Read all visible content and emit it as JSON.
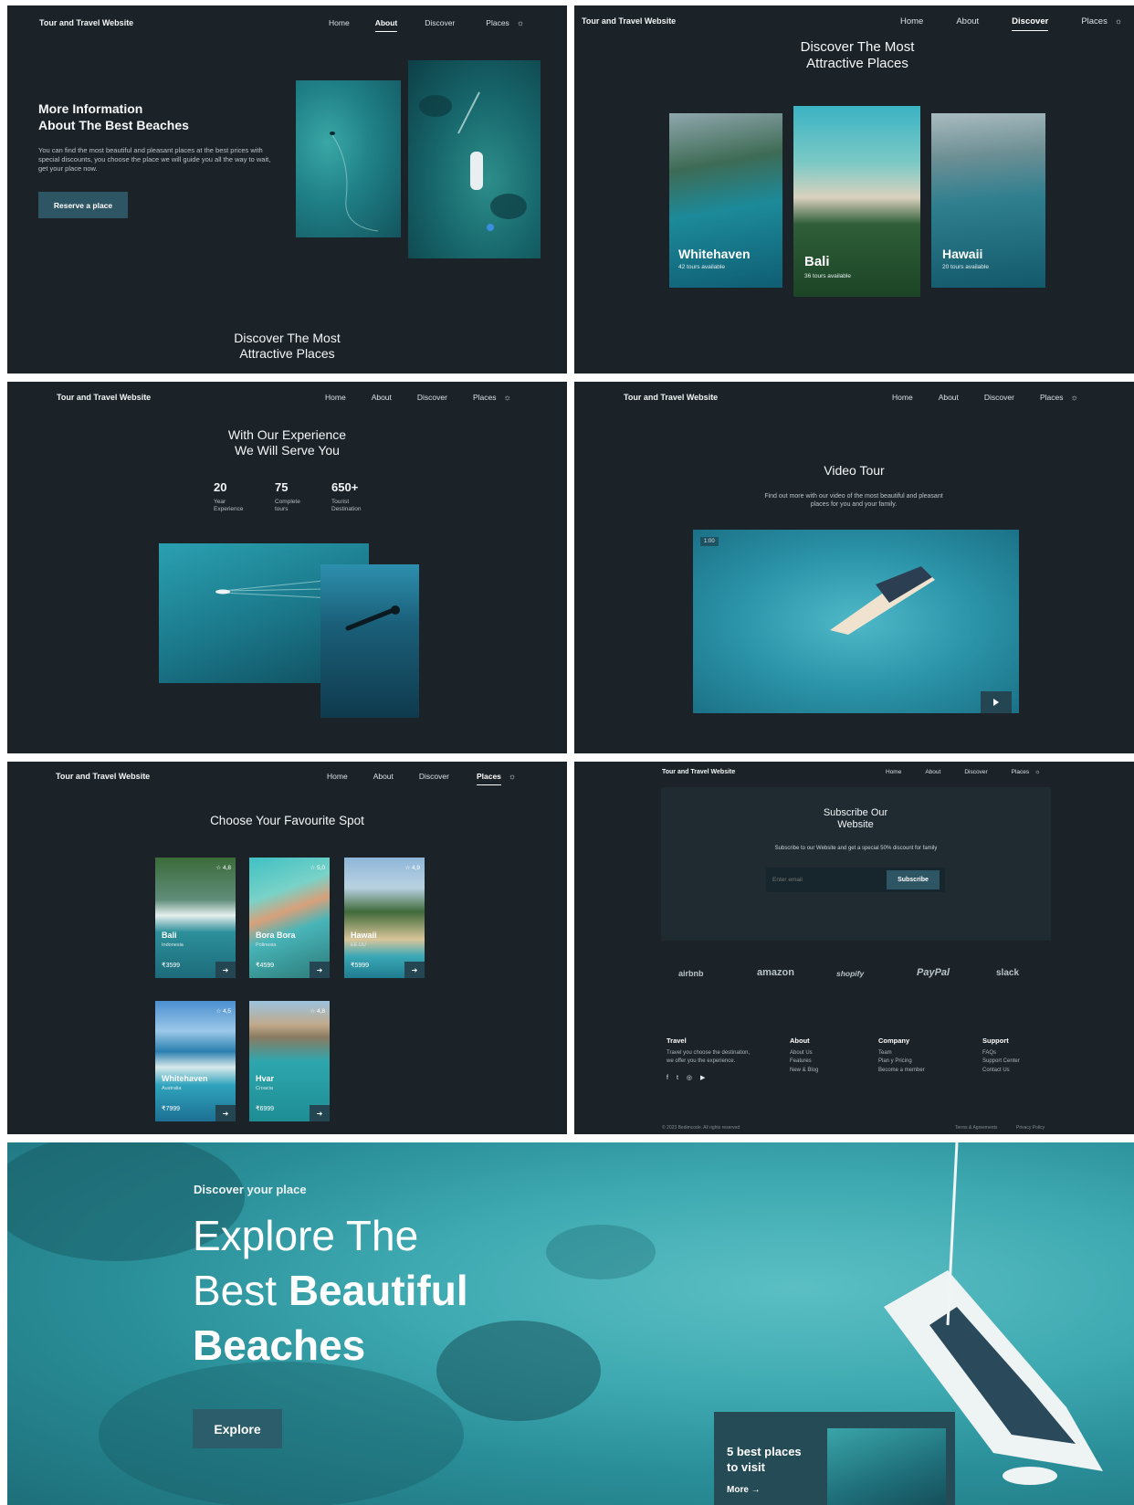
{
  "brand": "Tour and Travel Website",
  "nav": {
    "home": "Home",
    "about": "About",
    "discover": "Discover",
    "places": "Places",
    "theme_icon": "sun-icon"
  },
  "about": {
    "title": "More Information\nAbout The Best Beaches",
    "text": "You can find the most beautiful and pleasant places at the best prices with special discounts, you choose the place we will guide you all the way to wait, get your place now.",
    "button": "Reserve a place",
    "next_title": "Discover The Most\nAttractive Places"
  },
  "discover": {
    "title": "Discover The Most\nAttractive Places",
    "cards": [
      {
        "name": "Whitehaven",
        "tours": "42 tours available"
      },
      {
        "name": "Bali",
        "tours": "36 tours available"
      },
      {
        "name": "Hawaii",
        "tours": "20 tours available"
      }
    ]
  },
  "experience": {
    "title": "With Our Experience\nWe Will Serve You",
    "stats": [
      {
        "num": "20",
        "label": "Year\nExperience"
      },
      {
        "num": "75",
        "label": "Complete\ntours"
      },
      {
        "num": "650+",
        "label": "Tourist\nDestination"
      }
    ]
  },
  "video": {
    "title": "Video Tour",
    "text": "Find out more with our video of the most beautiful and pleasant places for you and your family.",
    "time": "1:00",
    "play_icon": "play-icon"
  },
  "places": {
    "title": "Choose Your Favourite Spot",
    "spots": [
      {
        "rating": "☆ 4,8",
        "name": "Bali",
        "country": "Indonesia",
        "price": "₹3599"
      },
      {
        "rating": "☆ 5,0",
        "name": "Bora Bora",
        "country": "Polinesia",
        "price": "₹4599"
      },
      {
        "rating": "☆ 4,9",
        "name": "Hawaii",
        "country": "EE.UU",
        "price": "₹5999"
      },
      {
        "rating": "☆ 4,5",
        "name": "Whitehaven",
        "country": "Australia",
        "price": "₹7999"
      },
      {
        "rating": "☆ 4,8",
        "name": "Hvar",
        "country": "Croacia",
        "price": "₹6999"
      }
    ]
  },
  "subscribe": {
    "title": "Subscribe Our\nWebsite",
    "text": "Subscribe to our Website and get a special 50% discount for family",
    "placeholder": "Enter email",
    "button": "Subscribe",
    "logos": [
      "airbnb",
      "amazon",
      "shopify",
      "PayPal",
      "slack"
    ]
  },
  "footer": {
    "travel": {
      "title": "Travel",
      "text": "Travel you choose the destination, we offer you the experience."
    },
    "about": {
      "title": "About",
      "items": [
        "About Us",
        "Features",
        "New & Blog"
      ]
    },
    "company": {
      "title": "Company",
      "items": [
        "Team",
        "Plan y Pricing",
        "Become a member"
      ]
    },
    "support": {
      "title": "Support",
      "items": [
        "FAQs",
        "Support Center",
        "Contact Us"
      ]
    },
    "copyright": "© 2023 Bedimcode. All rights reserved",
    "terms": "Terms & Agreements",
    "privacy": "Privacy Policy"
  },
  "hero": {
    "kicker": "Discover your place",
    "title_line1": "Explore The",
    "title_line2a": "Best ",
    "title_line2b": "Beautiful",
    "title_line3": "Beaches",
    "button": "Explore",
    "card_text": "5 best places\nto visit",
    "card_link": "More →"
  }
}
